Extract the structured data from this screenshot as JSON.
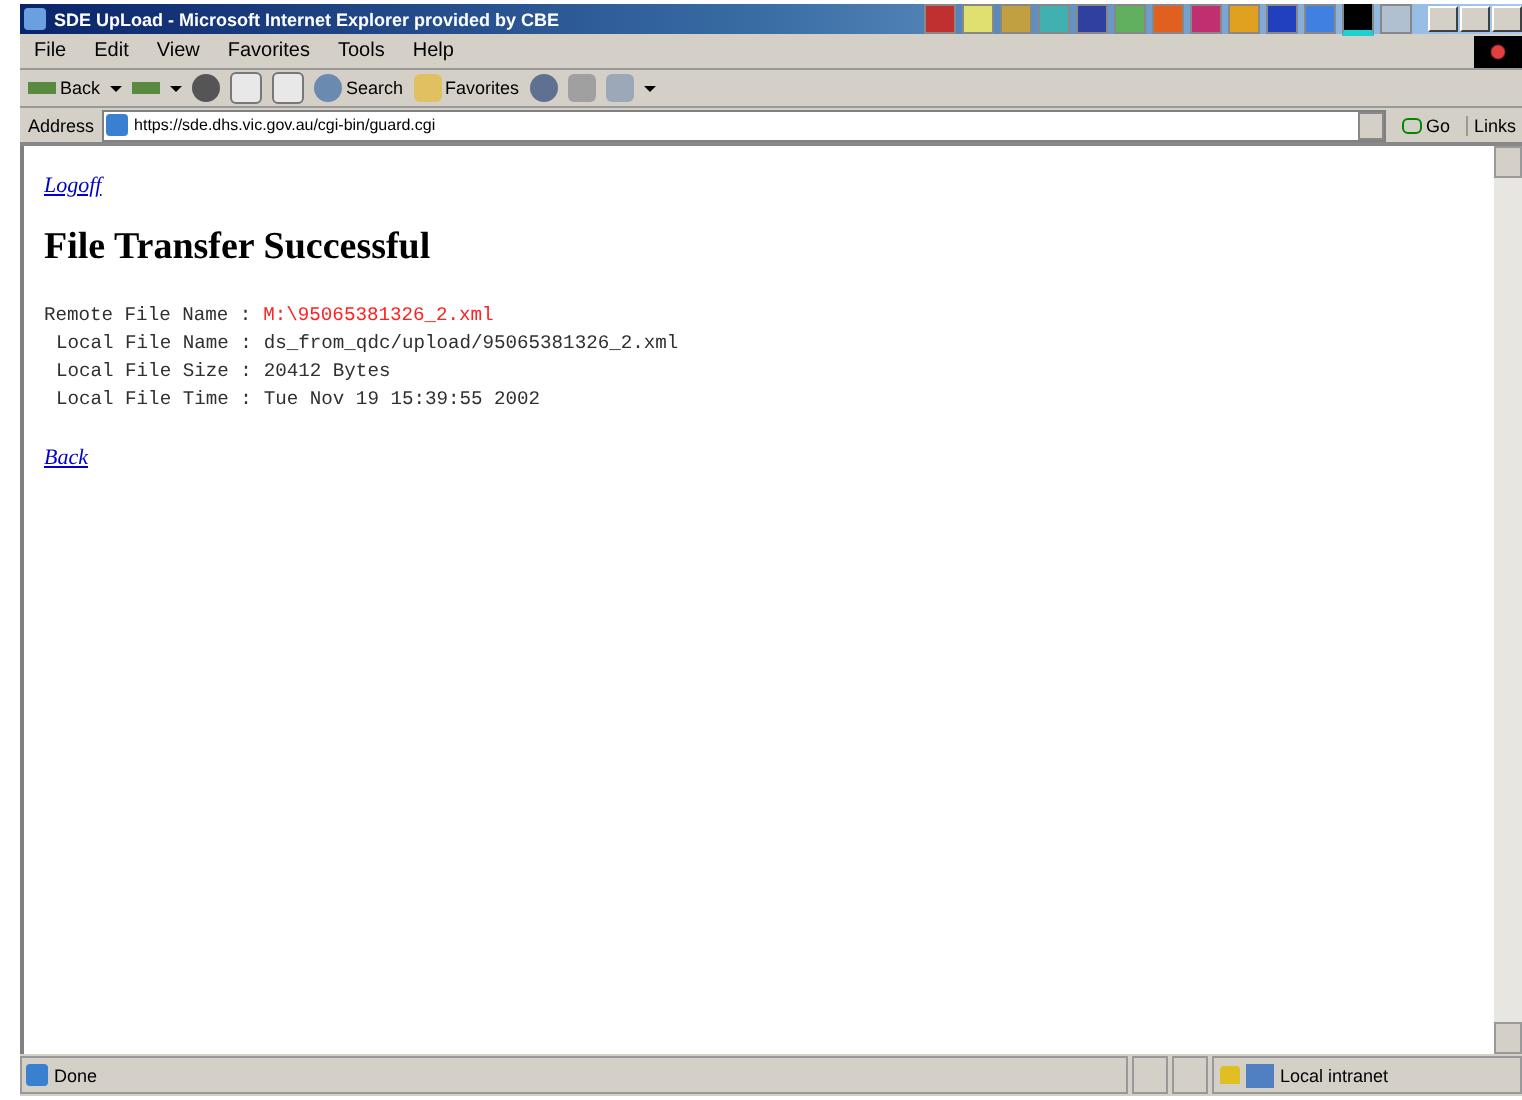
{
  "window": {
    "title": "SDE UpLoad - Microsoft Internet Explorer provided by CBE"
  },
  "menu": [
    "File",
    "Edit",
    "View",
    "Favorites",
    "Tools",
    "Help"
  ],
  "toolbar": [
    {
      "kind": "back",
      "label": "Back"
    },
    {
      "kind": "forward"
    },
    {
      "kind": "stop"
    },
    {
      "kind": "refresh"
    },
    {
      "kind": "home"
    },
    {
      "kind": "search",
      "label": "Search"
    },
    {
      "kind": "favorites",
      "label": "Favorites"
    },
    {
      "kind": "history"
    },
    {
      "kind": "print"
    },
    {
      "kind": "edit"
    }
  ],
  "address": {
    "label": "Address",
    "value": "https://sde.dhs.vic.gov.au/cgi-bin/guard.cgi",
    "go": "Go",
    "links": "Links"
  },
  "page": {
    "logoff": "Logoff",
    "heading": "File Transfer Successful",
    "lines": [
      {
        "label": "Remote File Name :",
        "value": "M:\\95065381326_2.xml",
        "color": "#ff2020",
        "indent": false
      },
      {
        "label": "Local File Name :",
        "value": "ds_from_qdc/upload/95065381326_2.xml",
        "color": "#303030",
        "indent": true
      },
      {
        "label": "Local File Size :",
        "value": "20412 Bytes",
        "color": "#303030",
        "indent": true
      },
      {
        "label": "Local File Time :",
        "value": "Tue Nov 19 15:39:55 2002",
        "color": "#303030",
        "indent": true
      }
    ],
    "back": "Back"
  },
  "status_bar": {
    "text": "Done",
    "zone": "Local intranet"
  }
}
